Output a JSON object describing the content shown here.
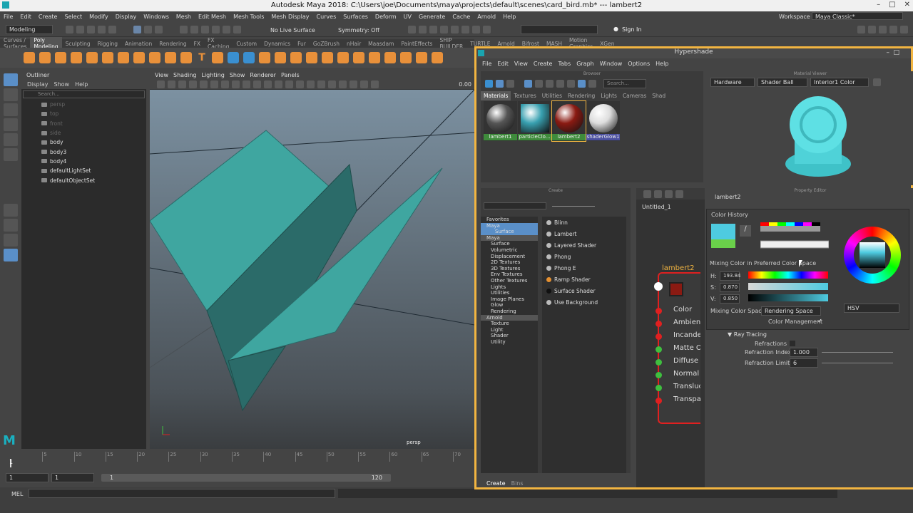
{
  "window_title": "Autodesk Maya 2018: C:\\Users\\joe\\Documents\\maya\\projects\\default\\scenes\\card_bird.mb*  ---  lambert2",
  "main_menu": [
    "File",
    "Edit",
    "Create",
    "Select",
    "Modify",
    "Display",
    "Windows",
    "Mesh",
    "Edit Mesh",
    "Mesh Tools",
    "Mesh Display",
    "Curves",
    "Surfaces",
    "Deform",
    "UV",
    "Generate",
    "Cache",
    "Arnold",
    "Help"
  ],
  "workspace_label": "Workspace :",
  "workspace_value": "Maya Classic*",
  "mode_menu": "Modeling",
  "live_surface": "No Live Surface",
  "symmetry": "Symmetry: Off",
  "sign_in": "Sign In",
  "shelf_tabs": [
    "Curves / Surfaces",
    "Poly Modeling",
    "Sculpting",
    "Rigging",
    "Animation",
    "Rendering",
    "FX",
    "FX Caching",
    "Custom",
    "Dynamics",
    "Fur",
    "GoZBrush",
    "nHair",
    "Maasdam",
    "PaintEffects",
    "SHIP BUILDER",
    "TURTLE",
    "Arnold",
    "Bifrost",
    "MASH",
    "Motion Graphics",
    "XGen"
  ],
  "outliner": {
    "title": "Outliner",
    "menu": [
      "Display",
      "Show",
      "Help"
    ],
    "search": "Search...",
    "items": [
      {
        "label": "persp",
        "dim": true
      },
      {
        "label": "top",
        "dim": true
      },
      {
        "label": "front",
        "dim": true
      },
      {
        "label": "side",
        "dim": true
      },
      {
        "label": "body",
        "dim": false
      },
      {
        "label": "body3",
        "dim": false
      },
      {
        "label": "body4",
        "dim": false
      },
      {
        "label": "defaultLightSet",
        "dim": false
      },
      {
        "label": "defaultObjectSet",
        "dim": false
      }
    ]
  },
  "viewport": {
    "menu": [
      "View",
      "Shading",
      "Lighting",
      "Show",
      "Renderer",
      "Panels"
    ],
    "camera": "persp",
    "value": "0.00"
  },
  "timeline": {
    "ticks": [
      "5",
      "10",
      "15",
      "20",
      "25",
      "30",
      "35",
      "40",
      "45",
      "50",
      "55",
      "60",
      "65",
      "70"
    ],
    "current": "1"
  },
  "range": {
    "start": "1",
    "start2": "1",
    "inner": "1",
    "end": "120"
  },
  "mel": "MEL",
  "hypershade": {
    "title": "Hypershade",
    "menu": [
      "File",
      "Edit",
      "View",
      "Create",
      "Tabs",
      "Graph",
      "Window",
      "Options",
      "Help"
    ],
    "browser_cap": "Browser",
    "search": "Search...",
    "tabs": [
      "Materials",
      "Textures",
      "Utilities",
      "Rendering",
      "Lights",
      "Cameras",
      "Shad"
    ],
    "swatches": [
      {
        "label": "lambert1",
        "color": "#555"
      },
      {
        "label": "particleClo...",
        "color": "#38a0b0"
      },
      {
        "label": "lambert2",
        "color": "#8a1a12"
      },
      {
        "label": "shaderGlow1",
        "color": "#ddd"
      }
    ],
    "create_cap": "Create",
    "categories": [
      "Favorites",
      "Maya",
      "Surface",
      "Maya",
      "Surface",
      "Volumetric",
      "Displacement",
      "2D Textures",
      "3D Textures",
      "Env Textures",
      "Other Textures",
      "Lights",
      "Utilities",
      "Image Planes",
      "Glow",
      "Rendering",
      "Arnold",
      "Texture",
      "Light",
      "Shader",
      "Utility"
    ],
    "shaders": [
      {
        "label": "Blinn",
        "color": "#bbb"
      },
      {
        "label": "Lambert",
        "color": "#bbb"
      },
      {
        "label": "Layered Shader",
        "color": "#bbb"
      },
      {
        "label": "Phong",
        "color": "#bbb"
      },
      {
        "label": "Phong E",
        "color": "#bbb"
      },
      {
        "label": "Ramp Shader",
        "color": "#e59030"
      },
      {
        "label": "Surface Shader",
        "color": "#111"
      },
      {
        "label": "Use Background",
        "color": "#bbb"
      }
    ],
    "bottom_tabs": [
      "Create",
      "Bins"
    ],
    "graph_tab": "Untitled_1",
    "node": {
      "name": "lambert2",
      "ports": [
        {
          "label": "Color",
          "color": "#e02020"
        },
        {
          "label": "Ambient",
          "color": "#e02020"
        },
        {
          "label": "Incandescence",
          "color": "#e02020"
        },
        {
          "label": "Matte Opacity",
          "color": "#3fbf3f"
        },
        {
          "label": "Diffuse",
          "color": "#3fbf3f"
        },
        {
          "label": "Normal Camera",
          "color": "#3fbf3f"
        },
        {
          "label": "Translucence",
          "color": "#3fbf3f"
        },
        {
          "label": "Transparency",
          "color": "#e02020"
        }
      ]
    },
    "mv_cap": "Material Viewer",
    "mv_renderer": "Hardware",
    "mv_shape": "Shader Ball",
    "mv_env": "Interior1 Color",
    "pe_cap": "Property Editor",
    "pe_node": "lambert2",
    "color_history": "Color History",
    "mixing": "Mixing Color in Preferred Color Space",
    "h_label": "H:",
    "h_value": "193.84",
    "s_label": "S:",
    "s_value": "0.870",
    "v_label": "V:",
    "v_value": "0.850",
    "mix_space_label": "Mixing Color Space:",
    "mix_space_value": "Rendering Space",
    "mode": "HSV",
    "color_mgmt": "Color Management",
    "raytracing": "Ray Tracing",
    "refractions": "Refractions",
    "refr_index_label": "Refraction Index",
    "refr_index": "1.000",
    "refr_limit_label": "Refraction Limit",
    "refr_limit": "6"
  },
  "colors": {
    "mesh": "#3fa6a0",
    "mesh_dark": "#2b6b69",
    "accent": "#f2b541",
    "swatch": "#4ecbe0",
    "shaderball": "#5ee0e4"
  }
}
